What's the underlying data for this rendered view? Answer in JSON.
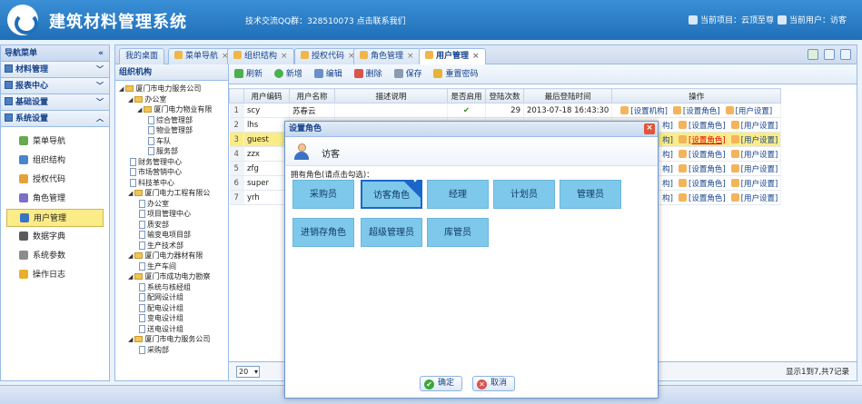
{
  "header": {
    "app_title": "建筑材料管理系统",
    "info": "技术交流QQ群：328510073 点击联系我们",
    "current_project": "当前项目：云顶至尊",
    "current_user": "当前用户：访客"
  },
  "sidebar": {
    "title": "导航菜单",
    "groups": [
      {
        "label": "材料管理"
      },
      {
        "label": "报表中心"
      },
      {
        "label": "基础设置"
      },
      {
        "label": "系统设置"
      }
    ],
    "items": [
      {
        "label": "菜单导航"
      },
      {
        "label": "组织结构"
      },
      {
        "label": "授权代码"
      },
      {
        "label": "角色管理"
      },
      {
        "label": "用户管理"
      },
      {
        "label": "数据字典"
      },
      {
        "label": "系统参数"
      },
      {
        "label": "操作日志"
      }
    ]
  },
  "tabs": [
    {
      "label": "我的桌面"
    },
    {
      "label": "菜单导航"
    },
    {
      "label": "组织结构"
    },
    {
      "label": "授权代码"
    },
    {
      "label": "角色管理"
    },
    {
      "label": "用户管理"
    }
  ],
  "tree": {
    "title": "组织机构",
    "nodes": [
      {
        "label": "厦门市电力服务公司"
      },
      {
        "label": "办公室"
      },
      {
        "label": "厦门电力物业有限"
      },
      {
        "label": "综合管理部"
      },
      {
        "label": "物业管理部"
      },
      {
        "label": "车队"
      },
      {
        "label": "服务部"
      },
      {
        "label": "财务管理中心"
      },
      {
        "label": "市场营销中心"
      },
      {
        "label": "科技革中心"
      },
      {
        "label": "厦门电力工程有限公"
      },
      {
        "label": "办公室"
      },
      {
        "label": "项目管理中心"
      },
      {
        "label": "质安部"
      },
      {
        "label": "输变电项目部"
      },
      {
        "label": "生产技术部"
      },
      {
        "label": "厦门电力器材有限"
      },
      {
        "label": "生产车间"
      },
      {
        "label": "厦门市成功电力勘察"
      },
      {
        "label": "系统与核经组"
      },
      {
        "label": "配网设计组"
      },
      {
        "label": "配电设计组"
      },
      {
        "label": "变电设计组"
      },
      {
        "label": "送电设计组"
      },
      {
        "label": "厦门市电力服务公司"
      },
      {
        "label": "采购部"
      }
    ]
  },
  "toolbar": {
    "refresh": "刷新",
    "add": "新增",
    "edit": "编辑",
    "delete": "删除",
    "save": "保存",
    "reset_pwd": "重置密码"
  },
  "grid": {
    "columns": [
      "用户编码",
      "用户名称",
      "描述说明",
      "是否启用",
      "登陆次数",
      "最后登陆时间",
      "操作"
    ],
    "rows": [
      {
        "n": "1",
        "code": "scy",
        "name": "苏春云",
        "desc": "",
        "enabled": "✔",
        "count": "29",
        "time": "2013-07-18 16:43:30"
      },
      {
        "n": "2",
        "code": "lhs",
        "name": "",
        "desc": "",
        "enabled": "",
        "count": "",
        "time": ""
      },
      {
        "n": "3",
        "code": "guest",
        "name": "",
        "desc": "",
        "enabled": "",
        "count": "",
        "time": ""
      },
      {
        "n": "4",
        "code": "zzx",
        "name": "",
        "desc": "",
        "enabled": "",
        "count": "",
        "time": ""
      },
      {
        "n": "5",
        "code": "zfg",
        "name": "",
        "desc": "",
        "enabled": "",
        "count": "",
        "time": ""
      },
      {
        "n": "6",
        "code": "super",
        "name": "",
        "desc": "",
        "enabled": "",
        "count": "",
        "time": ""
      },
      {
        "n": "7",
        "code": "yrh",
        "name": "",
        "desc": "",
        "enabled": "",
        "count": "",
        "time": ""
      }
    ],
    "op_org": "[设置机构]",
    "op_org_short": "构]",
    "op_role": "[设置角色]",
    "op_user": "[用户设置]"
  },
  "pager": {
    "page_size": "20",
    "summary": "显示1到7,共7记录"
  },
  "dialog": {
    "title": "设置角色",
    "user_name": "访客",
    "owned_label": "拥有角色(请点击勾选)：",
    "roles": [
      {
        "label": "采购员",
        "checked": false
      },
      {
        "label": "访客角色",
        "checked": true
      },
      {
        "label": "经理",
        "checked": false
      },
      {
        "label": "计划员",
        "checked": false
      },
      {
        "label": "管理员",
        "checked": false
      },
      {
        "label": "进销存角色",
        "checked": false
      },
      {
        "label": "超级管理员",
        "checked": false
      },
      {
        "label": "库管员",
        "checked": false
      }
    ],
    "ok_label": "确定",
    "cancel_label": "取消"
  },
  "colors": {
    "header_bg": "#1f6fb8",
    "role_tile": "#7ec8eb",
    "role_selected_border": "#1b66c9",
    "row_selected": "#fbec88"
  }
}
